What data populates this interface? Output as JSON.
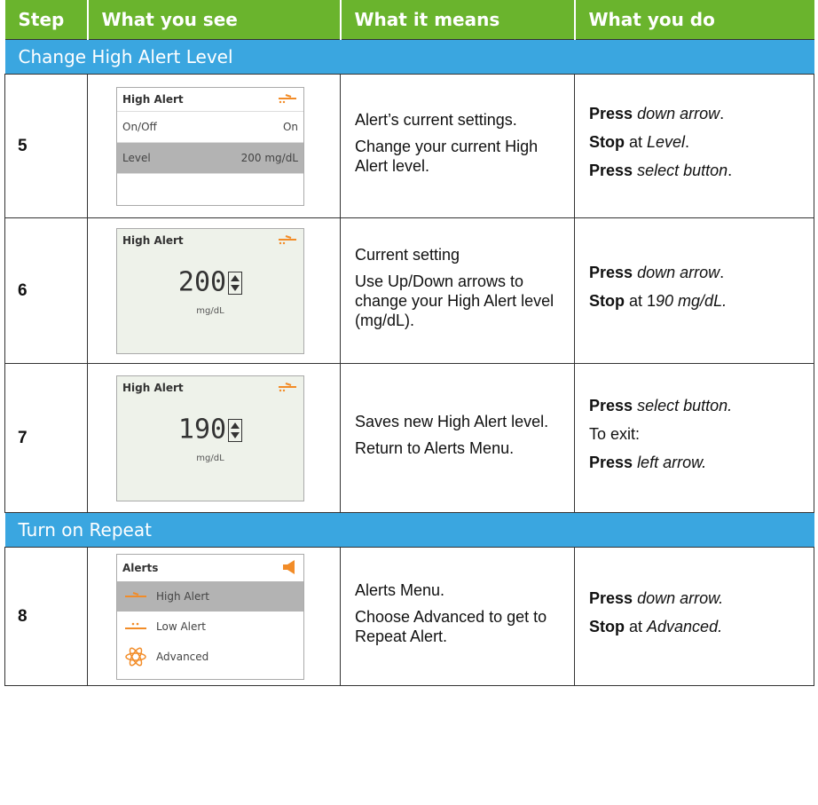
{
  "header": {
    "step": "Step",
    "see": "What you see",
    "means": "What it means",
    "do": "What you do"
  },
  "sections": {
    "s1": "Change High Alert Level",
    "s2": "Turn on Repeat"
  },
  "rows": {
    "r5": {
      "step": "5",
      "screen": {
        "title": "High Alert",
        "row1_label": "On/Off",
        "row1_value": "On",
        "row2_label": "Level",
        "row2_value": "200 mg/dL"
      },
      "means": [
        "Alert’s current settings.",
        "Change your current High Alert level."
      ],
      "do": [
        {
          "b": "Press",
          "i": "down arrow",
          "t": "."
        },
        {
          "b": "Stop",
          "t2": " at ",
          "i": "Level",
          "t": "."
        },
        {
          "b": "Press",
          "i": "select button",
          "t": "."
        }
      ]
    },
    "r6": {
      "step": "6",
      "screen": {
        "title": "High Alert",
        "value": "200",
        "unit": "mg/dL"
      },
      "means": [
        "Current setting",
        "Use Up/Down arrows to change your High Alert level (mg/dL)."
      ],
      "do": [
        {
          "b": "Press",
          "i": "down arrow",
          "t": "."
        },
        {
          "b": "Stop",
          "t2": " at 1",
          "i": "90 mg/dL.",
          "t": ""
        }
      ]
    },
    "r7": {
      "step": "7",
      "screen": {
        "title": "High Alert",
        "value": "190",
        "unit": "mg/dL"
      },
      "means": [
        "Saves new High Alert level.",
        "Return to Alerts Menu."
      ],
      "do": [
        {
          "b": "Press",
          "i": "select button.",
          "t": ""
        },
        {
          "plain": "To exit:"
        },
        {
          "b": "Press",
          "i": "left arrow.",
          "t": ""
        }
      ]
    },
    "r8": {
      "step": "8",
      "screen": {
        "title": "Alerts",
        "item1": "High Alert",
        "item2": "Low Alert",
        "item3": "Advanced"
      },
      "means": [
        "Alerts Menu.",
        "Choose Advanced to get to Repeat Alert."
      ],
      "do": [
        {
          "b": "Press",
          "i": "down arrow.",
          "t": ""
        },
        {
          "b": "Stop",
          "t2": " at ",
          "i": "Advanced.",
          "t": ""
        }
      ]
    }
  },
  "colors": {
    "header": "#6ab42d",
    "section": "#3aa6e0",
    "icon": "#f28c28"
  },
  "icons": {
    "high": "high-alert-icon",
    "low": "low-alert-icon",
    "speaker": "speaker-icon",
    "advanced": "advanced-icon",
    "stepper": "up-down-arrows-icon"
  }
}
